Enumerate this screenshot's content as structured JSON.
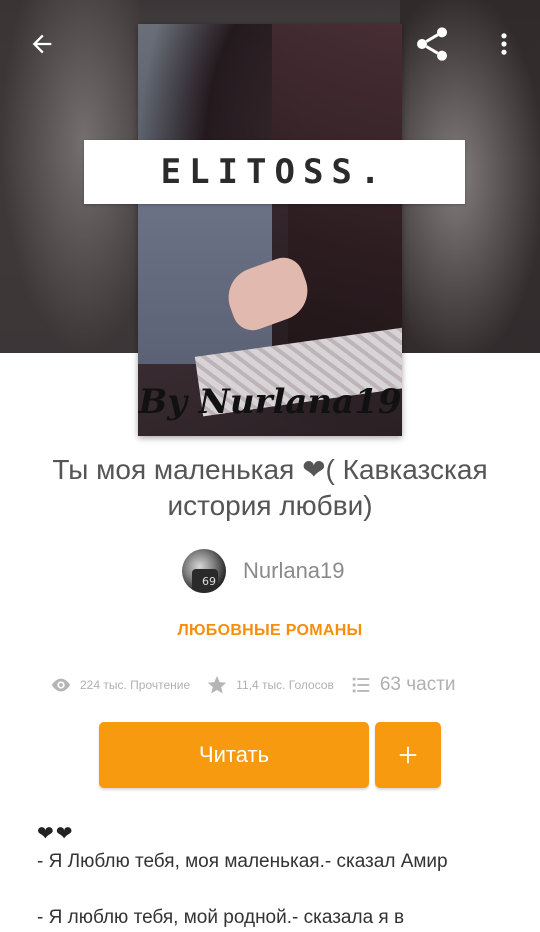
{
  "cover": {
    "banner_text": "ELITOSS.",
    "byline": "By Nurlana19"
  },
  "story": {
    "title": "Ты моя маленькая ❤( Кавказская история любви)",
    "author": "Nurlana19",
    "genre": "ЛЮБОВНЫЕ РОМАНЫ"
  },
  "stats": {
    "reads": "224 тыс. Прочтение",
    "votes": "11,4 тыс. Голосов",
    "parts": "63 части"
  },
  "actions": {
    "read_label": "Читать",
    "add_label": "+"
  },
  "description": {
    "hearts": "❤❤",
    "line1": "- Я Люблю тебя, моя маленькая.- сказал Амир",
    "line2": "- Я люблю тебя, мой родной.- сказала я в"
  },
  "icons": {
    "back": "arrow-left-icon",
    "share": "share-icon",
    "more": "more-vertical-icon",
    "reads": "eye-icon",
    "votes": "star-icon",
    "parts": "list-icon"
  },
  "colors": {
    "accent": "#f89a10",
    "genre": "#f68d0b"
  }
}
